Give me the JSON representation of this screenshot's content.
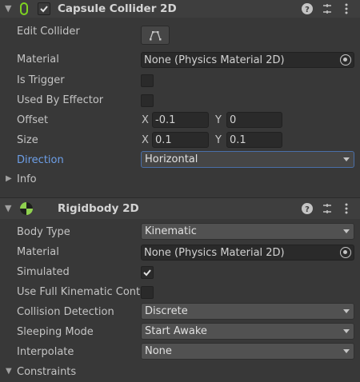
{
  "capsule": {
    "title": "Capsule Collider 2D",
    "edit_collider_label": "Edit Collider",
    "material_label": "Material",
    "material_value": "None (Physics Material 2D)",
    "is_trigger_label": "Is Trigger",
    "used_by_effector_label": "Used By Effector",
    "offset_label": "Offset",
    "offset_x_axis": "X",
    "offset_x": "-0.1",
    "offset_y_axis": "Y",
    "offset_y": "0",
    "size_label": "Size",
    "size_x_axis": "X",
    "size_x": "0.1",
    "size_y_axis": "Y",
    "size_y": "0.1",
    "direction_label": "Direction",
    "direction_value": "Horizontal",
    "info_label": "Info",
    "is_trigger_checked": false,
    "used_by_effector_checked": false,
    "enabled": true
  },
  "rigidbody": {
    "title": "Rigidbody 2D",
    "body_type_label": "Body Type",
    "body_type_value": "Kinematic",
    "material_label": "Material",
    "material_value": "None (Physics Material 2D)",
    "simulated_label": "Simulated",
    "simulated_checked": true,
    "use_full_kinematic_label": "Use Full Kinematic Contacts",
    "use_full_kinematic_checked": false,
    "collision_detection_label": "Collision Detection",
    "collision_detection_value": "Discrete",
    "sleeping_mode_label": "Sleeping Mode",
    "sleeping_mode_value": "Start Awake",
    "interpolate_label": "Interpolate",
    "interpolate_value": "None",
    "constraints_label": "Constraints"
  },
  "icons": {
    "help": "help-icon",
    "presets": "presets-icon",
    "more": "more-options-icon",
    "capsule_component": "capsule-collider-icon",
    "rigidbody_component": "rigidbody-icon",
    "edit_collider": "edit-collider-icon",
    "object_picker": "object-picker-icon"
  },
  "colors": {
    "background": "#383838",
    "header": "#3e3e3e",
    "direction_label": "#6d9fe8",
    "capsule_icon": "#7ed321",
    "rigidbody_icon": "#8fd14f"
  }
}
